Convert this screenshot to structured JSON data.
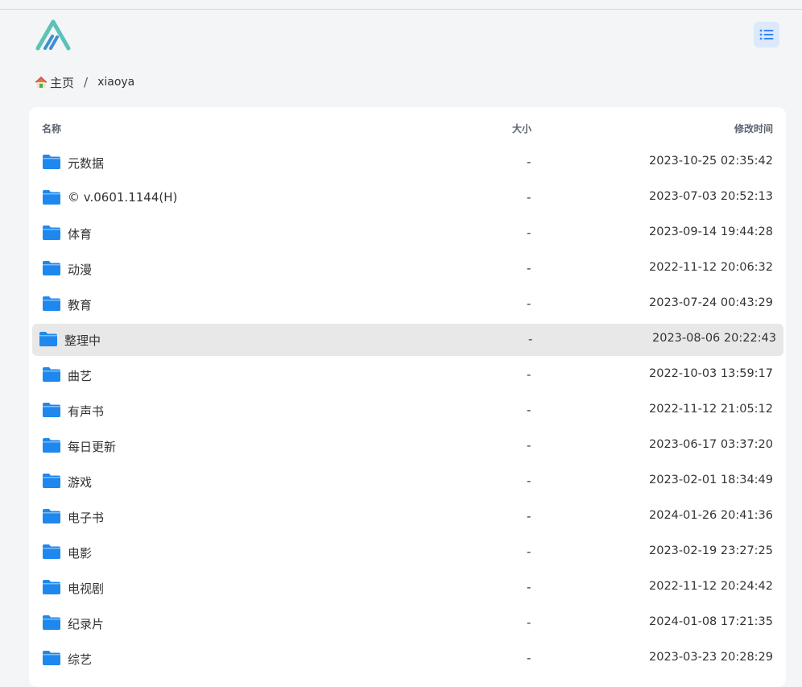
{
  "breadcrumb": {
    "home_label": "主页",
    "separator": "/",
    "current": "xiaoya"
  },
  "table": {
    "headers": {
      "name": "名称",
      "size": "大小",
      "modified": "修改时间"
    },
    "rows": [
      {
        "name": "元数据",
        "size": "-",
        "modified": "2023-10-25 02:35:42"
      },
      {
        "name": "© v.0601.1144(H)",
        "size": "-",
        "modified": "2023-07-03 20:52:13"
      },
      {
        "name": "体育",
        "size": "-",
        "modified": "2023-09-14 19:44:28"
      },
      {
        "name": "动漫",
        "size": "-",
        "modified": "2022-11-12 20:06:32"
      },
      {
        "name": "教育",
        "size": "-",
        "modified": "2023-07-24 00:43:29"
      },
      {
        "name": "整理中",
        "size": "-",
        "modified": "2023-08-06 20:22:43"
      },
      {
        "name": "曲艺",
        "size": "-",
        "modified": "2022-10-03 13:59:17"
      },
      {
        "name": "有声书",
        "size": "-",
        "modified": "2022-11-12 21:05:12"
      },
      {
        "name": "每日更新",
        "size": "-",
        "modified": "2023-06-17 03:37:20"
      },
      {
        "name": "游戏",
        "size": "-",
        "modified": "2023-02-01 18:34:49"
      },
      {
        "name": "电子书",
        "size": "-",
        "modified": "2024-01-26 20:41:36"
      },
      {
        "name": "电影",
        "size": "-",
        "modified": "2023-02-19 23:27:25"
      },
      {
        "name": "电视剧",
        "size": "-",
        "modified": "2022-11-12 20:24:42"
      },
      {
        "name": "纪录片",
        "size": "-",
        "modified": "2024-01-08 17:21:35"
      },
      {
        "name": "综艺",
        "size": "-",
        "modified": "2023-03-23 20:28:29"
      }
    ],
    "highlighted_row": "整理中"
  },
  "icons": {
    "logo": "alist-logo-icon",
    "layout_toggle": "list-view-icon",
    "home": "house-icon",
    "folder": "folder-icon"
  },
  "colors": {
    "folder": "#1e88ef",
    "accent": "#3b82f6",
    "toggle_bg": "#dbe9fb",
    "logo_teal": "#5cc2b7",
    "hover_row": "#e8e8e9"
  }
}
